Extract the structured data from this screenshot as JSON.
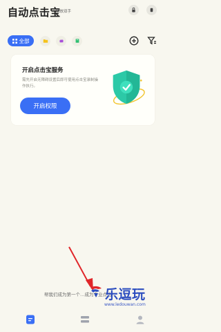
{
  "header": {
    "title": "自动点击宝",
    "subtitle": "解放双手"
  },
  "tabs": {
    "all_label": "全部"
  },
  "permission_card": {
    "title": "开启点击宝服务",
    "description": "需先开启无障碍设置后即可使用点击宝录制操作执行。",
    "button_label": "开启权限"
  },
  "empty_state": {
    "tip": "帮我们成为第一个…成为专业点击…"
  },
  "watermark": {
    "name": "乐逗玩",
    "url": "www.ledouwan.com"
  },
  "colors": {
    "accent": "#3a6ff5",
    "background": "#f8f7ef",
    "shield": "#25c7a6",
    "arrow": "#e0262a"
  },
  "icons": {
    "lock": "lock-icon",
    "menu": "menu-icon",
    "grid": "grid-icon",
    "folder": "folder-icon",
    "cloud": "cloud-icon",
    "book": "book-icon",
    "add": "add-icon",
    "filter": "filter-icon",
    "shield": "shield-check-icon"
  }
}
